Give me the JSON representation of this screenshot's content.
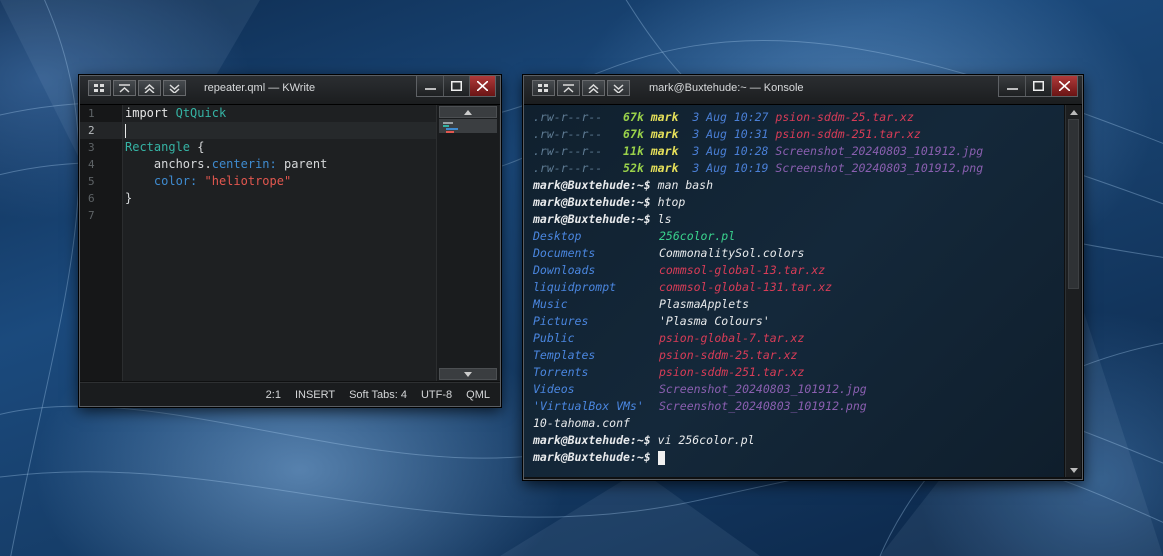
{
  "colors": {
    "accent_red": "#b03a3a",
    "desktop_blue": "#1b4a7d"
  },
  "kwrite": {
    "title": "repeater.qml — KWrite",
    "titlebar_icons": [
      "application-menu-icon",
      "keep-below-icon",
      "keep-above-icon",
      "shade-icon"
    ],
    "line_numbers": [
      "1",
      "2",
      "3",
      "4",
      "5",
      "6",
      "7"
    ],
    "code": {
      "l1_kw": "import",
      "l1_mod": "QtQuick",
      "l3_type": "Rectangle",
      "l3_brace": "{",
      "l4_indent": "    ",
      "l4_obj": "anchors",
      "l4_dot": ".",
      "l4_prop": "centerin:",
      "l4_val": "parent",
      "l5_indent": "    ",
      "l5_prop": "color:",
      "l5_val": "\"heliotrope\"",
      "l6_close": "}"
    },
    "status": {
      "position": "2:1",
      "mode": "INSERT",
      "indent": "Soft Tabs: 4",
      "encoding": "UTF-8",
      "syntax": "QML"
    }
  },
  "konsole": {
    "title": "mark@Buxtehude:~ — Konsole",
    "listing": [
      {
        "perm": ".rw-r--r--",
        "size": "67k",
        "user": "mark",
        "date": "3 Aug 10:27",
        "name": "psion-sddm-25.tar.xz",
        "kind": "archive"
      },
      {
        "perm": ".rw-r--r--",
        "size": "67k",
        "user": "mark",
        "date": "3 Aug 10:31",
        "name": "psion-sddm-251.tar.xz",
        "kind": "archive"
      },
      {
        "perm": ".rw-r--r--",
        "size": "11k",
        "user": "mark",
        "date": "3 Aug 10:28",
        "name": "Screenshot_20240803_101912.jpg",
        "kind": "image"
      },
      {
        "perm": ".rw-r--r--",
        "size": "52k",
        "user": "mark",
        "date": "3 Aug 10:19",
        "name": "Screenshot_20240803_101912.png",
        "kind": "image"
      }
    ],
    "prompt": "mark@Buxtehude:~$",
    "commands": [
      "man bash",
      "htop",
      "ls",
      "vi 256color.pl"
    ],
    "ls_left": [
      {
        "name": "Desktop",
        "kind": "dir"
      },
      {
        "name": "Documents",
        "kind": "dir"
      },
      {
        "name": "Downloads",
        "kind": "dir"
      },
      {
        "name": "liquidprompt",
        "kind": "dir"
      },
      {
        "name": "Music",
        "kind": "dir"
      },
      {
        "name": "Pictures",
        "kind": "dir"
      },
      {
        "name": "Public",
        "kind": "dir"
      },
      {
        "name": "Templates",
        "kind": "dir"
      },
      {
        "name": "Torrents",
        "kind": "dir"
      },
      {
        "name": "Videos",
        "kind": "dir"
      },
      {
        "name": "'VirtualBox VMs'",
        "kind": "dir"
      },
      {
        "name": "10-tahoma.conf",
        "kind": "file"
      }
    ],
    "ls_right": [
      {
        "name": "256color.pl",
        "kind": "exe"
      },
      {
        "name": "CommonalitySol.colors",
        "kind": "file"
      },
      {
        "name": "commsol-global-13.tar.xz",
        "kind": "archive"
      },
      {
        "name": "commsol-global-131.tar.xz",
        "kind": "archive"
      },
      {
        "name": "PlasmaApplets",
        "kind": "file"
      },
      {
        "name": "'Plasma Colours'",
        "kind": "file"
      },
      {
        "name": "psion-global-7.tar.xz",
        "kind": "archive"
      },
      {
        "name": "psion-sddm-25.tar.xz",
        "kind": "archive"
      },
      {
        "name": "psion-sddm-251.tar.xz",
        "kind": "archive"
      },
      {
        "name": "Screenshot_20240803_101912.jpg",
        "kind": "image"
      },
      {
        "name": "Screenshot_20240803_101912.png",
        "kind": "image"
      }
    ]
  }
}
